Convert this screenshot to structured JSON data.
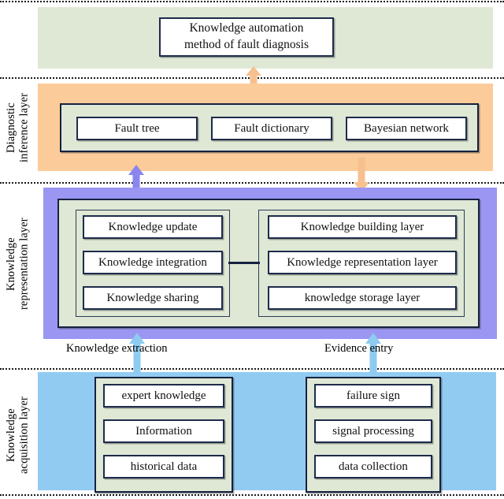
{
  "diagram": {
    "title": "Knowledge automation method of fault diagnosis architecture",
    "colors": {
      "top_band": "#dfe8d5",
      "inference_band": "#fbcb99",
      "representation_band": "#9a96f2",
      "acquisition_band": "#92cbf2",
      "panel_fill": "#dfe8d5",
      "node_fill": "#ffffff",
      "node_border": "#1d2b4a",
      "arrow_orange": "#f7c08f",
      "arrow_purple": "#8a86ee",
      "arrow_blue": "#8ecbf0"
    }
  },
  "top": {
    "title_box": "Knowledge automation\nmethod of fault diagnosis"
  },
  "layers": {
    "inference": {
      "caption": "Diagnostic\ninference layer",
      "nodes": [
        {
          "label": "Fault tree"
        },
        {
          "label": "Fault dictionary"
        },
        {
          "label": "Bayesian network"
        }
      ]
    },
    "representation": {
      "caption": "Knowledge\nrepresentation layer",
      "left_nodes": [
        {
          "label": "Knowledge update"
        },
        {
          "label": "Knowledge integration"
        },
        {
          "label": "Knowledge sharing"
        }
      ],
      "right_nodes": [
        {
          "label": "Knowledge building layer"
        },
        {
          "label": "Knowledge representation layer"
        },
        {
          "label": "knowledge storage layer"
        }
      ]
    },
    "acquisition": {
      "caption": "Knowledge\nacquisition layer",
      "left_nodes": [
        {
          "label": "expert knowledge"
        },
        {
          "label": "Information"
        },
        {
          "label": "historical data"
        }
      ],
      "right_nodes": [
        {
          "label": "failure sign"
        },
        {
          "label": "signal processing"
        },
        {
          "label": "data collection"
        }
      ]
    }
  },
  "arrow_labels": {
    "knowledge_extraction": "Knowledge extraction",
    "evidence_entry": "Evidence entry"
  }
}
